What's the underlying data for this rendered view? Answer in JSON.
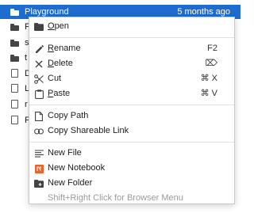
{
  "filebrowser": {
    "rows": [
      {
        "type": "folder",
        "name": "Playground",
        "modified": "5 months ago",
        "selected": true
      },
      {
        "type": "folder",
        "name": "F"
      },
      {
        "type": "folder",
        "name": "s"
      },
      {
        "type": "folder",
        "name": "t"
      },
      {
        "type": "file",
        "name": "D"
      },
      {
        "type": "file",
        "name": "L"
      },
      {
        "type": "file",
        "name": "r"
      },
      {
        "type": "file",
        "name": "F"
      }
    ]
  },
  "menu": {
    "open": {
      "first": "O",
      "rest": "pen",
      "icon": "folder-icon"
    },
    "rename": {
      "first": "R",
      "rest": "ename",
      "shortcut": "F2",
      "icon": "pencil-icon"
    },
    "delete": {
      "first": "D",
      "rest": "elete",
      "shortcut": "⌦",
      "icon": "close-icon"
    },
    "cut": {
      "label": "Cut",
      "shortcut": "⌘ X",
      "icon": "scissors-icon"
    },
    "paste": {
      "first": "P",
      "rest": "aste",
      "shortcut": "⌘ V",
      "icon": "clipboard-icon"
    },
    "copy_path": {
      "label": "Copy Path",
      "icon": "file-icon"
    },
    "copy_link": {
      "label": "Copy Shareable Link",
      "icon": "link-icon"
    },
    "new_file": {
      "label": "New File",
      "icon": "text-lines-icon"
    },
    "new_notebook": {
      "label": "New Notebook",
      "icon": "notebook-icon"
    },
    "new_folder": {
      "label": "New Folder",
      "icon": "new-folder-icon"
    },
    "hint": "Shift+Right Click for Browser Menu"
  },
  "colors": {
    "selection": "#1e6ccf",
    "notebook_icon": "#e8622c",
    "hint_text": "#9a9a9a"
  }
}
